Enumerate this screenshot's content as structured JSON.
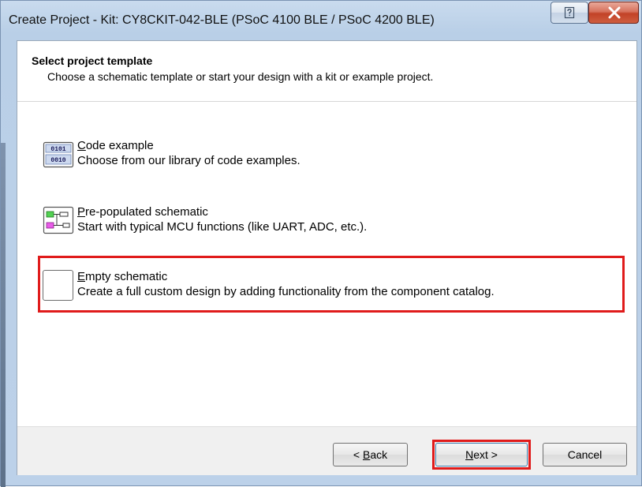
{
  "window": {
    "title": "Create Project - Kit: CY8CKIT-042-BLE (PSoC 4100 BLE / PSoC 4200 BLE)",
    "help_button": "?",
    "close_button": "X"
  },
  "header": {
    "title": "Select project template",
    "subtitle": "Choose a schematic template or start your design with a kit or example project."
  },
  "options": [
    {
      "icon": "binary-code-icon",
      "accel": "C",
      "title_rest": "ode example",
      "description": "Choose from our library of code examples."
    },
    {
      "icon": "schematic-icon",
      "accel": "P",
      "title_rest": "re-populated schematic",
      "description": "Start with typical MCU functions (like UART, ADC, etc.)."
    },
    {
      "icon": "empty-box-icon",
      "accel": "E",
      "title_rest": "mpty schematic",
      "description": "Create a full custom design by adding functionality from the component catalog."
    }
  ],
  "buttons": {
    "back_prefix": "< ",
    "back_accel": "B",
    "back_rest": "ack",
    "next_accel": "N",
    "next_rest": "ext >",
    "cancel": "Cancel"
  },
  "colors": {
    "highlight": "#e01b1b"
  }
}
